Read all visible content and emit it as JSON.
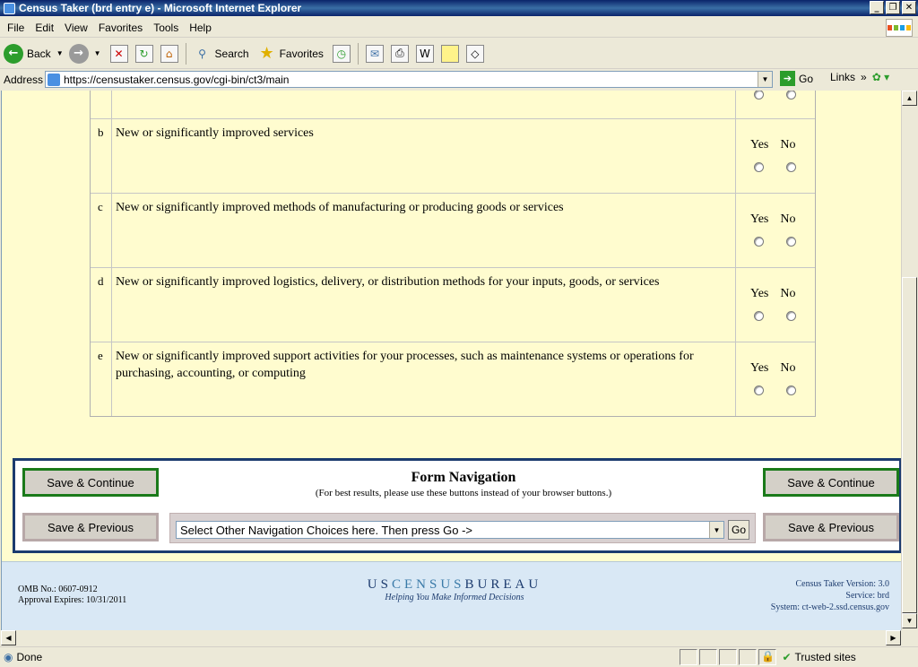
{
  "window": {
    "title": "Census Taker (brd entry e) - Microsoft Internet Explorer"
  },
  "menu": [
    "File",
    "Edit",
    "View",
    "Favorites",
    "Tools",
    "Help"
  ],
  "toolbar": {
    "back": "Back",
    "search": "Search",
    "favorites": "Favorites"
  },
  "address": {
    "label": "Address",
    "url": "https://censustaker.census.gov/cgi-bin/ct3/main",
    "go": "Go",
    "links": "Links"
  },
  "questions": [
    {
      "letter": "b",
      "text": "New or significantly improved services",
      "yes": "Yes",
      "no": "No"
    },
    {
      "letter": "c",
      "text": "New or significantly improved methods of manufacturing or producing goods or services",
      "yes": "Yes",
      "no": "No"
    },
    {
      "letter": "d",
      "text": "New or significantly improved logistics, delivery, or distribution methods for your inputs, goods, or services",
      "yes": "Yes",
      "no": "No"
    },
    {
      "letter": "e",
      "text": "New or significantly improved support activities for your processes, such as maintenance systems or operations for purchasing, accounting, or computing",
      "yes": "Yes",
      "no": "No"
    }
  ],
  "nav": {
    "title": "Form Navigation",
    "subtitle": "(For best results, please use these buttons instead of your browser buttons.)",
    "save_continue": "Save & Continue",
    "save_previous": "Save & Previous",
    "select_value": "Select Other Navigation Choices here. Then press Go ->",
    "go": "Go"
  },
  "footer": {
    "omb": "OMB No.: 0607-0912",
    "approval": "Approval Expires: 10/31/2011",
    "logo_us": "US",
    "logo_census": "CENSUS",
    "logo_bureau": "BUREAU",
    "tagline": "Helping You Make Informed Decisions",
    "version": "Census Taker Version: 3.0",
    "service": "Service: brd",
    "system": "System: ct-web-2.ssd.census.gov"
  },
  "status": {
    "text": "Done",
    "zone": "Trusted sites"
  }
}
